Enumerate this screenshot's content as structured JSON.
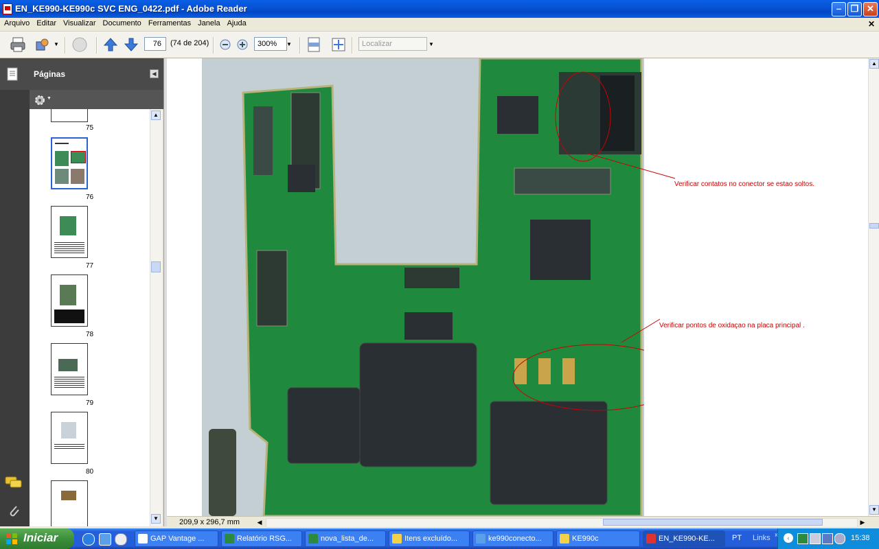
{
  "window": {
    "title": "EN_KE990-KE990c SVC ENG_0422.pdf - Adobe Reader"
  },
  "menu": [
    "Arquivo",
    "Editar",
    "Visualizar",
    "Documento",
    "Ferramentas",
    "Janela",
    "Ajuda"
  ],
  "toolbar": {
    "page_value": "76",
    "page_of": "(74 de 204)",
    "zoom": "300%",
    "find_placeholder": "Localizar"
  },
  "nav": {
    "pages_label": "Páginas"
  },
  "thumbnails": [
    {
      "label": "75"
    },
    {
      "label": "76"
    },
    {
      "label": "77"
    },
    {
      "label": "78"
    },
    {
      "label": "79"
    },
    {
      "label": "80"
    }
  ],
  "annotations": {
    "note1": "Verificar contatos no conector se estao soltos.",
    "note2": "Verificar pontos de oxidaçao na placa principal ."
  },
  "status": {
    "page_size": "209,9 x 296,7 mm"
  },
  "taskbar": {
    "start": "Iniciar",
    "tasks": [
      "GAP Vantage ...",
      "Relatório RSG...",
      "nova_lista_de...",
      "Itens excluído...",
      "ke990conecto...",
      "KE990c",
      "EN_KE990-KE..."
    ],
    "lang": "PT",
    "links": "Links",
    "clock": "15:38"
  },
  "colors": {
    "annotation": "#cc0000",
    "pcb_green": "#1f8a3e",
    "chip": "#2a2f33"
  }
}
